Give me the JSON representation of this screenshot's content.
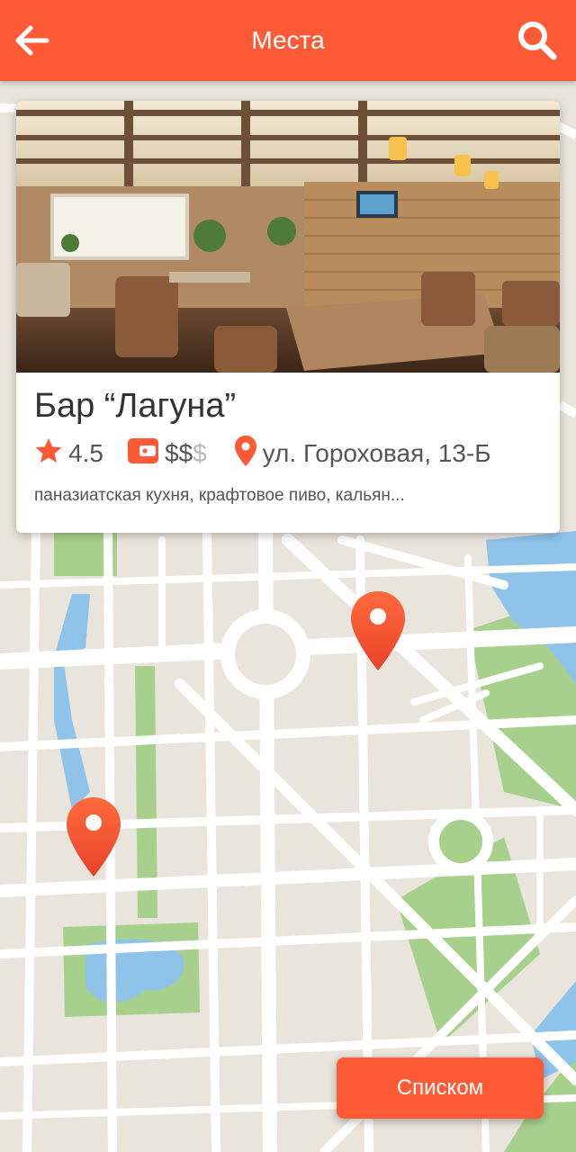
{
  "header": {
    "title": "Места",
    "back_icon": "arrow-left-icon",
    "search_icon": "search-icon"
  },
  "place_card": {
    "name": "Бар “Лагуна”",
    "rating": "4.5",
    "price_active": "$$",
    "price_inactive": "$",
    "address": "ул. Гороховая, 13-Б",
    "tags": "паназиатская кухня, крафтовое пиво, кальян...",
    "icons": [
      "star-icon",
      "wallet-icon",
      "location-pin-icon"
    ]
  },
  "map": {
    "markers": 2,
    "marker_icon": "map-marker-icon"
  },
  "list_button": {
    "label": "Списком"
  },
  "colors": {
    "accent": "#ff5a36",
    "map_bg": "#e9e4dc",
    "park": "#a8d08d",
    "water": "#8fc3ea",
    "road": "#ffffff"
  }
}
